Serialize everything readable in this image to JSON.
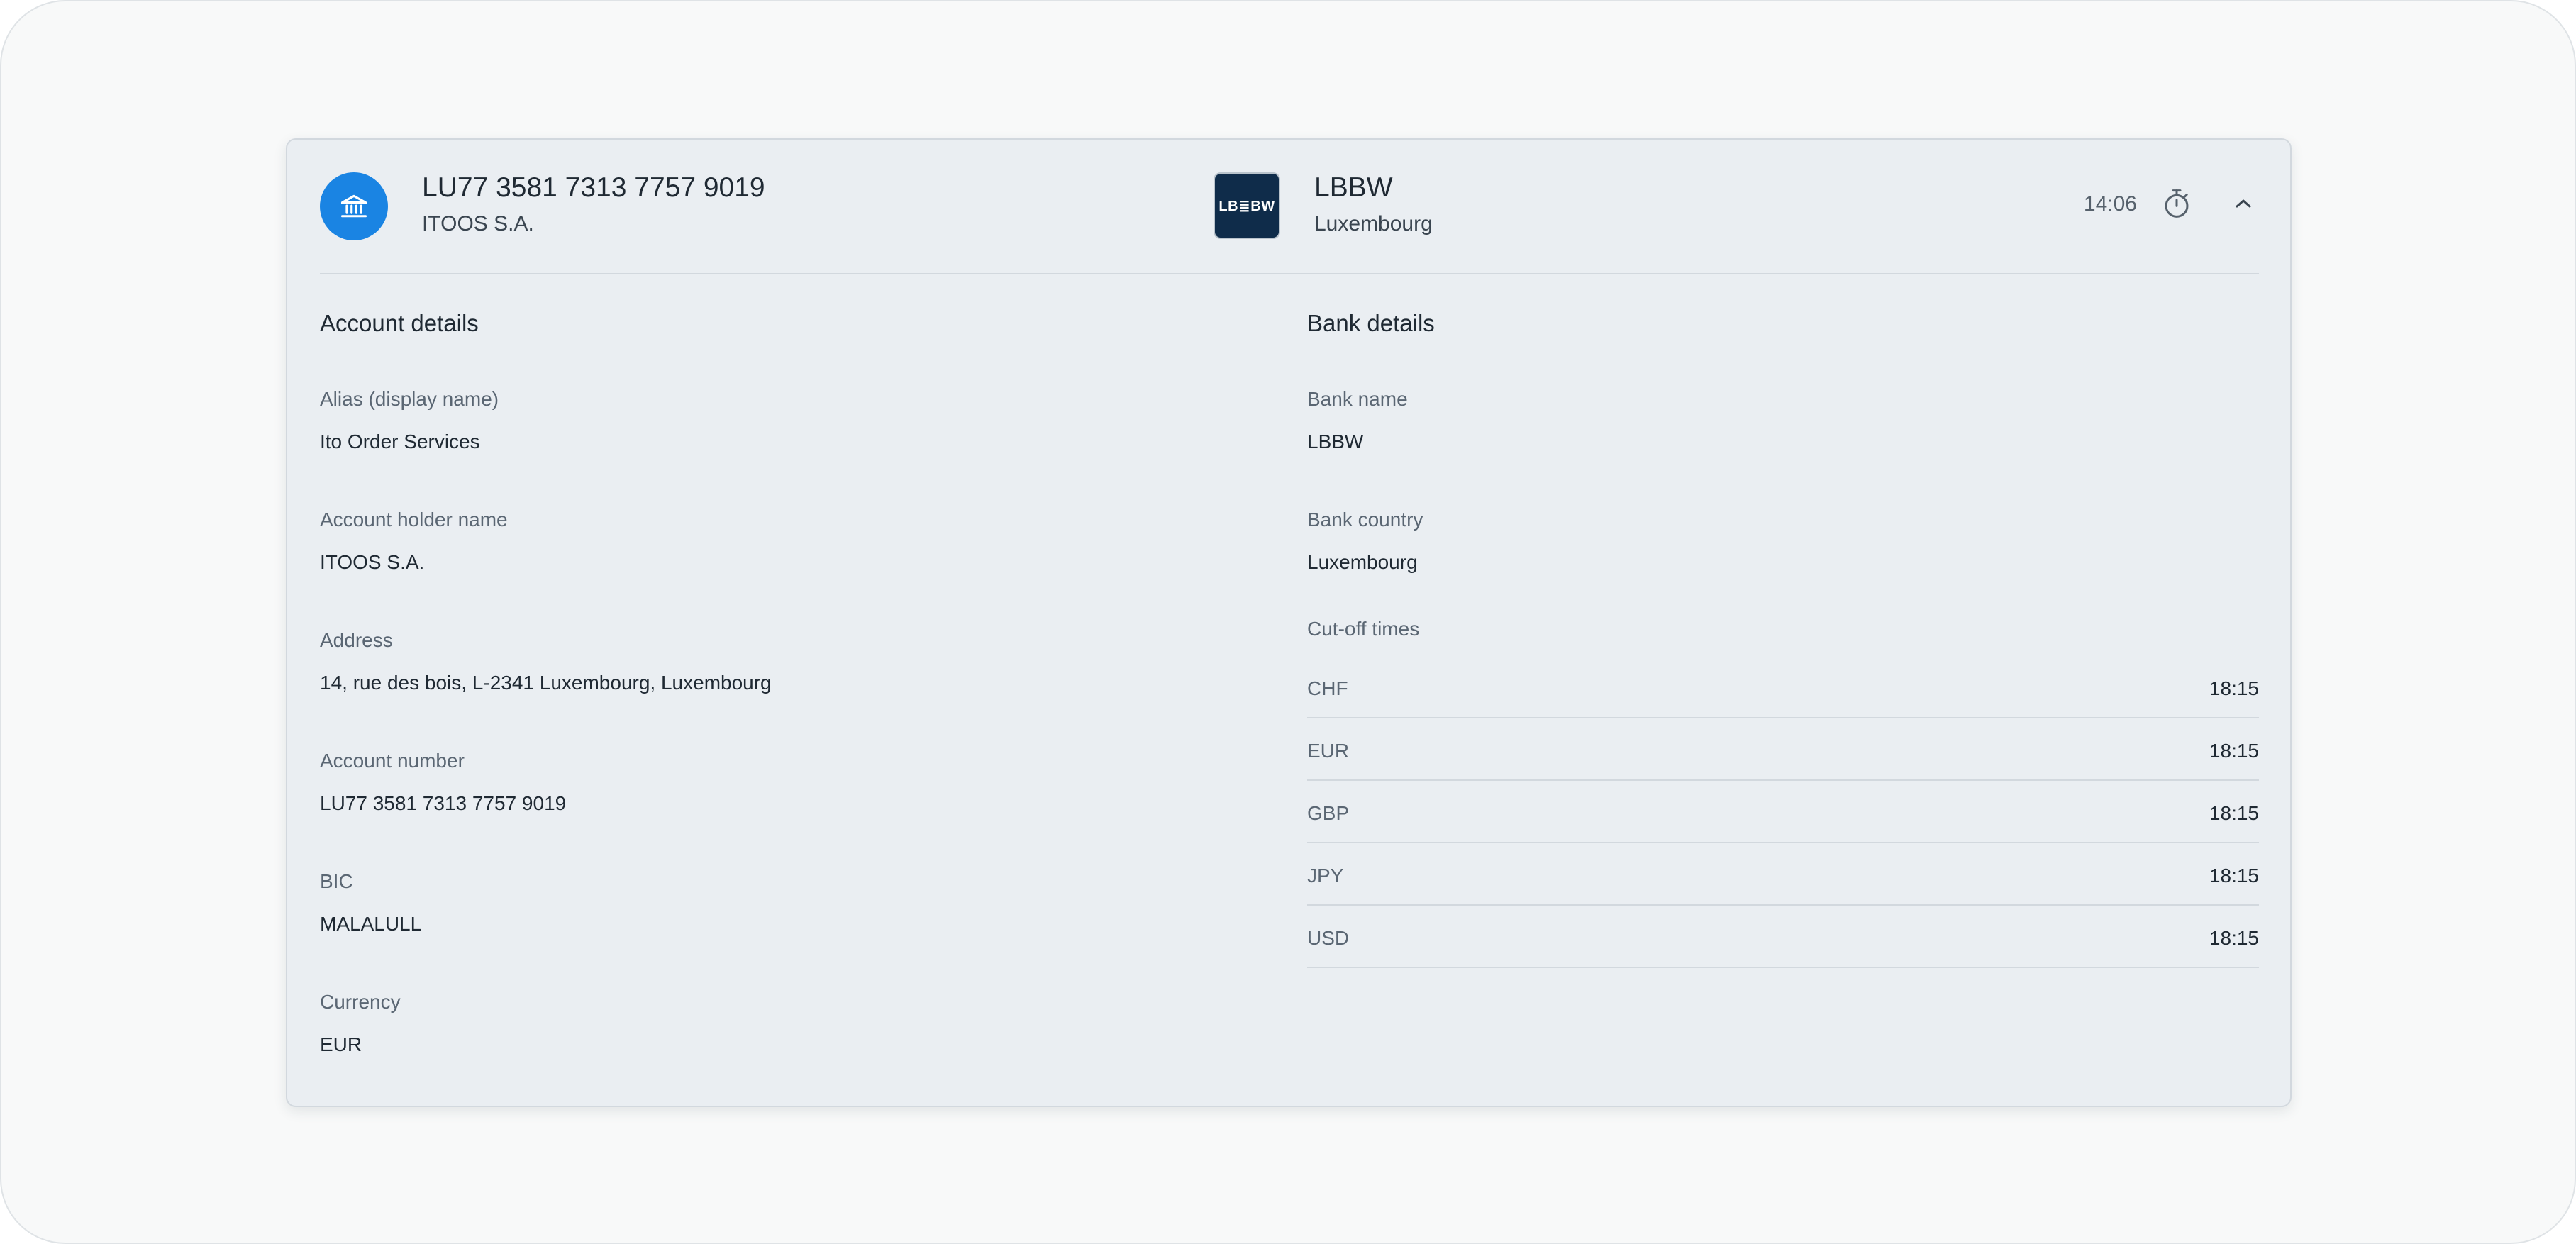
{
  "header": {
    "iban": "LU77 3581 7313 7757 9019",
    "holder": "ITOOS S.A.",
    "bank_logo_text": "LB≣BW",
    "bank_name": "LBBW",
    "bank_country": "Luxembourg",
    "time": "14:06",
    "icons": {
      "account": "bank-building-icon",
      "timer": "stopwatch-icon",
      "collapse": "chevron-up-icon"
    },
    "accent_color": "#1a84e3"
  },
  "account_details": {
    "title": "Account details",
    "fields": [
      {
        "label": "Alias (display name)",
        "value": "Ito Order Services"
      },
      {
        "label": "Account holder name",
        "value": "ITOOS S.A."
      },
      {
        "label": "Address",
        "value": "14, rue des bois, L-2341 Luxembourg, Luxembourg"
      },
      {
        "label": "Account number",
        "value": "LU77 3581 7313 7757 9019"
      },
      {
        "label": "BIC",
        "value": "MALALULL"
      },
      {
        "label": "Currency",
        "value": "EUR"
      }
    ]
  },
  "bank_details": {
    "title": "Bank details",
    "fields": [
      {
        "label": "Bank name",
        "value": "LBBW"
      },
      {
        "label": "Bank country",
        "value": "Luxembourg"
      }
    ],
    "cutoff_title": "Cut-off times",
    "cutoffs": [
      {
        "currency": "CHF",
        "time": "18:15"
      },
      {
        "currency": "EUR",
        "time": "18:15"
      },
      {
        "currency": "GBP",
        "time": "18:15"
      },
      {
        "currency": "JPY",
        "time": "18:15"
      },
      {
        "currency": "USD",
        "time": "18:15"
      }
    ]
  }
}
